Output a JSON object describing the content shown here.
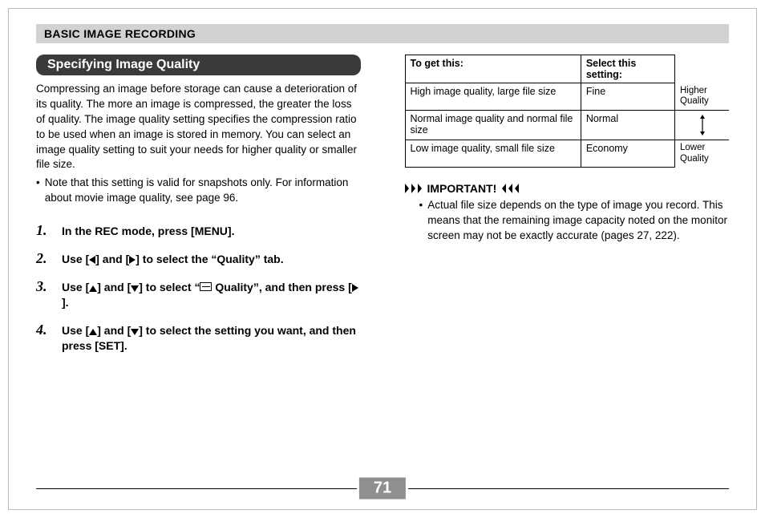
{
  "header": "BASIC IMAGE RECORDING",
  "section_title": "Specifying Image Quality",
  "intro": "Compressing an image before storage can cause a deterioration of its quality. The more an image is compressed, the greater the loss of quality. The image quality setting specifies the compression ratio to be used when an image is stored in memory. You can select an image quality setting to suit your needs for higher quality or smaller file size.",
  "note": "Note that this setting is valid for snapshots only. For information about movie image quality, see page 96.",
  "steps": [
    {
      "n": "1.",
      "pre": "In the REC mode, press [MENU]."
    },
    {
      "n": "2.",
      "pre": "Use [",
      "mid": "] and [",
      "post": "] to select the “Quality” tab.",
      "icons": [
        "left",
        "right"
      ]
    },
    {
      "n": "3.",
      "pre": "Use [",
      "mid": "] and [",
      "post_a": "] to select “",
      "post_b": " Quality”, and then press [",
      "post_c": "].",
      "icons": [
        "up",
        "down",
        "rect",
        "right"
      ]
    },
    {
      "n": "4.",
      "pre": "Use [",
      "mid": "] and [",
      "post": "] to select the setting you want, and then press [SET].",
      "icons": [
        "up",
        "down"
      ]
    }
  ],
  "table": {
    "headers": [
      "To get this:",
      "Select this setting:"
    ],
    "rows": [
      {
        "desc": "High image quality, large file size",
        "setting": "Fine",
        "side": "Higher Quality"
      },
      {
        "desc": "Normal image quality and normal file size",
        "setting": "Normal",
        "side": ""
      },
      {
        "desc": "Low image quality, small file size",
        "setting": "Economy",
        "side": "Lower Quality"
      }
    ]
  },
  "important_label": "IMPORTANT!",
  "important_text": "Actual file size depends on the type of image you record. This means that the remaining image capacity noted on the monitor screen may not be exactly accurate (pages 27, 222).",
  "page_number": "71"
}
